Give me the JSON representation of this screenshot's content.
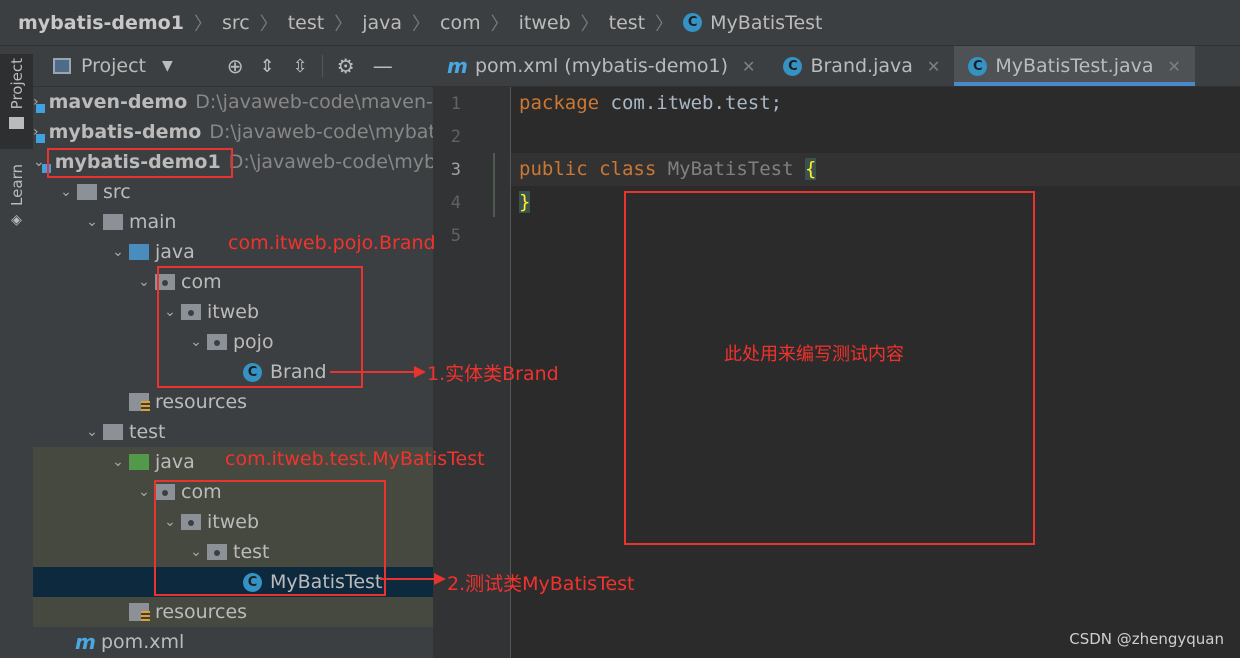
{
  "breadcrumb": [
    "mybatis-demo1",
    "src",
    "test",
    "java",
    "com",
    "itweb",
    "test",
    "MyBatisTest"
  ],
  "side_strip": {
    "project_label": "Project",
    "learn_label": "Learn"
  },
  "project_panel": {
    "title": "Project"
  },
  "tree": [
    {
      "arrow": "›",
      "label": "maven-demo",
      "path": "D:\\javaweb-code\\maven-d"
    },
    {
      "arrow": "›",
      "label": "mybatis-demo",
      "path": "D:\\javaweb-code\\mybat"
    },
    {
      "arrow": "⌄",
      "label": "mybatis-demo1",
      "path": "D:\\javaweb-code\\myba"
    },
    {
      "arrow": "⌄",
      "label": "src"
    },
    {
      "arrow": "⌄",
      "label": "main"
    },
    {
      "arrow": "⌄",
      "label": "java"
    },
    {
      "arrow": "⌄",
      "label": "com"
    },
    {
      "arrow": "⌄",
      "label": "itweb"
    },
    {
      "arrow": "⌄",
      "label": "pojo"
    },
    {
      "arrow": "",
      "label": "Brand"
    },
    {
      "arrow": "",
      "label": "resources"
    },
    {
      "arrow": "⌄",
      "label": "test"
    },
    {
      "arrow": "⌄",
      "label": "java"
    },
    {
      "arrow": "⌄",
      "label": "com"
    },
    {
      "arrow": "⌄",
      "label": "itweb"
    },
    {
      "arrow": "⌄",
      "label": "test"
    },
    {
      "arrow": "",
      "label": "MyBatisTest"
    },
    {
      "arrow": "",
      "label": "resources"
    },
    {
      "arrow": "",
      "label": "pom.xml"
    }
  ],
  "tabs": [
    {
      "label": "pom.xml (mybatis-demo1)",
      "icon": "m"
    },
    {
      "label": "Brand.java",
      "icon": "C"
    },
    {
      "label": "MyBatisTest.java",
      "icon": "C"
    }
  ],
  "line_numbers": [
    "1",
    "2",
    "3",
    "4",
    "5"
  ],
  "code": {
    "l1_kw": "package",
    "l1_rest": " com.itweb.test;",
    "l3_kw": "public class",
    "l3_cls": " MyBatisTest ",
    "l3_brace": "{",
    "l4_brace": "}"
  },
  "annotations": {
    "pojo_package": "com.itweb.pojo.Brand",
    "test_package": "com.itweb.test.MyBatisTest",
    "entity_note": "1.实体类Brand",
    "test_note": "2.测试类MyBatisTest",
    "editor_note": "此处用来编写测试内容"
  },
  "icons": {
    "class_icon_glyph": "C",
    "maven_glyph": "m"
  },
  "colors": {
    "accent": "#4a88c7",
    "annotation_red": "#e8332e",
    "keyword": "#cc7832"
  },
  "watermark": "CSDN @zhengyquan"
}
